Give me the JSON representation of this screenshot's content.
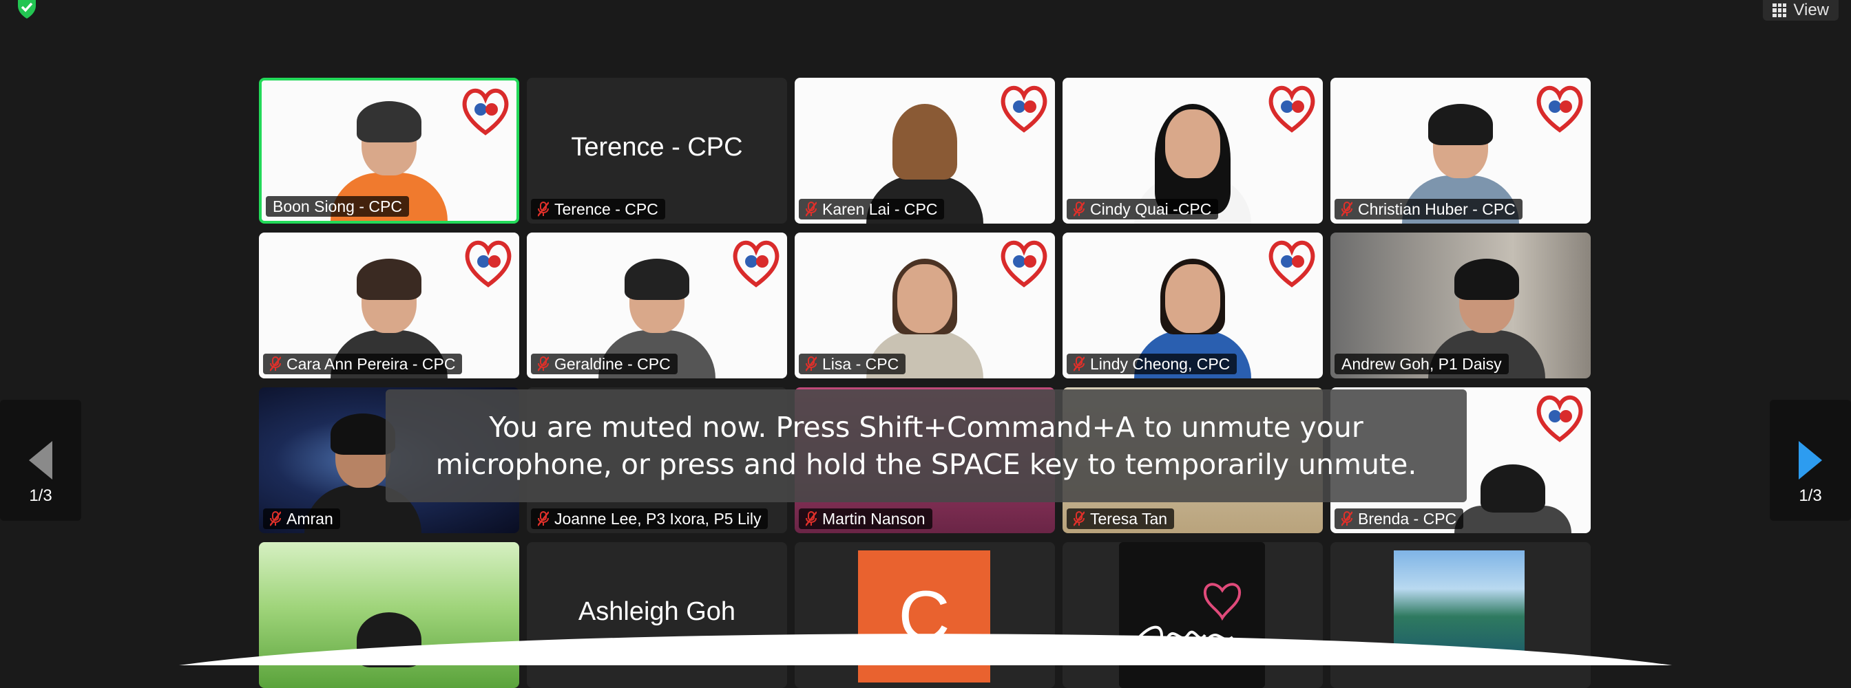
{
  "toolbar": {
    "view_label": "View"
  },
  "toast": {
    "line1": "You are muted now. Press Shift+Command+A to unmute your",
    "line2": "microphone, or press and hold the SPACE key to temporarily unmute."
  },
  "pagination": {
    "left_page": "1/3",
    "right_page": "1/3"
  },
  "tiles": [
    {
      "name": "Boon Siong - CPC",
      "muted": false,
      "active": true
    },
    {
      "name": "Terence - CPC",
      "display_name": "Terence - CPC",
      "muted": true
    },
    {
      "name": "Karen Lai - CPC",
      "muted": true
    },
    {
      "name": "Cindy Quai -CPC",
      "muted": true
    },
    {
      "name": "Christian Huber - CPC",
      "muted": true
    },
    {
      "name": "Cara Ann Pereira - CPC",
      "muted": true
    },
    {
      "name": "Geraldine - CPC",
      "muted": true
    },
    {
      "name": "Lisa - CPC",
      "muted": true
    },
    {
      "name": "Lindy Cheong, CPC",
      "muted": true
    },
    {
      "name": "Andrew Goh, P1 Daisy",
      "muted": false
    },
    {
      "name": "Amran",
      "muted": true
    },
    {
      "name": "Joanne Lee, P3 Ixora, P5 Lily",
      "muted": true
    },
    {
      "name": "Martin Nanson",
      "muted": true
    },
    {
      "name": "Teresa Tan",
      "muted": true
    },
    {
      "name": "Brenda - CPC",
      "muted": true
    },
    {
      "name": "",
      "muted": false
    },
    {
      "name": "",
      "display_name": "Ashleigh Goh",
      "muted": false
    },
    {
      "name": "",
      "avatar_letter": "C",
      "muted": false
    },
    {
      "name": "",
      "muted": false
    },
    {
      "name": "",
      "muted": false
    }
  ],
  "colors": {
    "active_border": "#23d959",
    "mute_red": "#e0302a",
    "avatar_orange": "#e9622f"
  }
}
